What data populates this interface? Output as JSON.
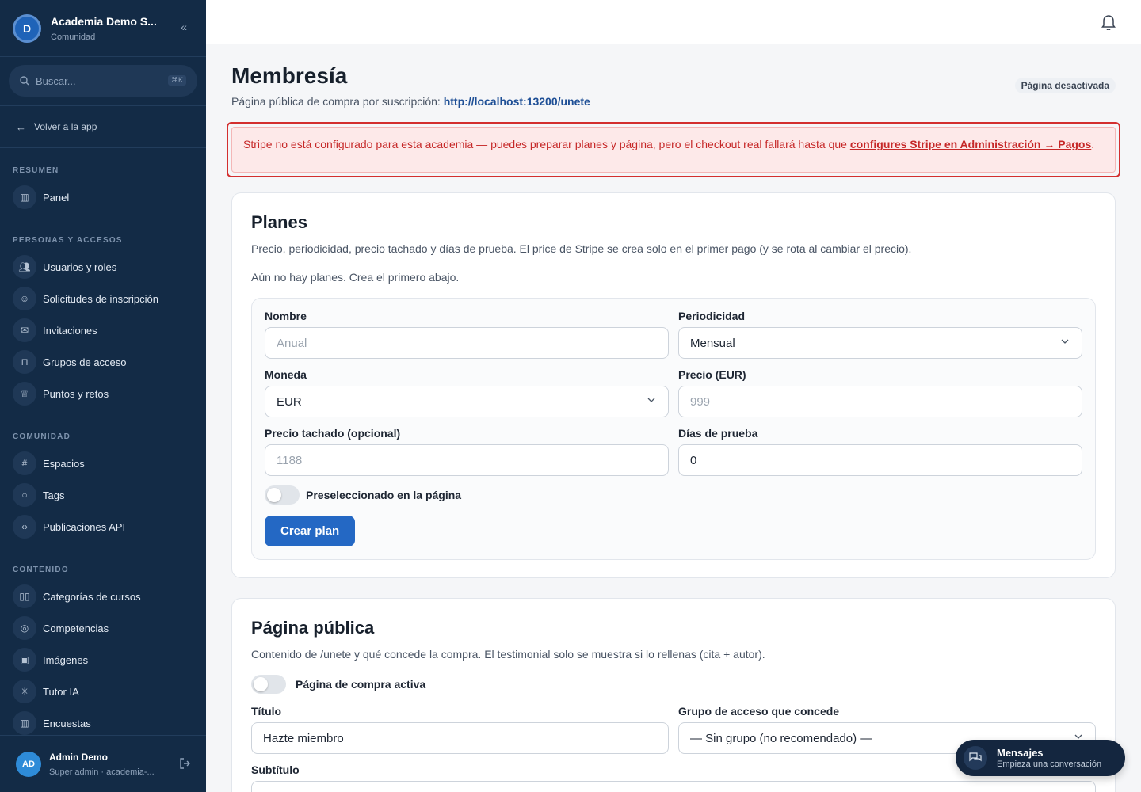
{
  "brand": {
    "name": "Academia Demo S...",
    "subtitle": "Comunidad",
    "logo_text": "D"
  },
  "search": {
    "placeholder": "Buscar...",
    "shortcut": "⌘K"
  },
  "back": {
    "label": "Volver a la app"
  },
  "sections": [
    {
      "title": "RESUMEN",
      "items": [
        {
          "label": "Panel",
          "icon": "chart-icon"
        }
      ]
    },
    {
      "title": "PERSONAS Y ACCESOS",
      "items": [
        {
          "label": "Usuarios y roles",
          "icon": "users-icon"
        },
        {
          "label": "Solicitudes de inscripción",
          "icon": "user-icon"
        },
        {
          "label": "Invitaciones",
          "icon": "mail-icon"
        },
        {
          "label": "Grupos de acceso",
          "icon": "lock-icon"
        },
        {
          "label": "Puntos y retos",
          "icon": "trophy-icon"
        }
      ]
    },
    {
      "title": "COMUNIDAD",
      "items": [
        {
          "label": "Espacios",
          "icon": "hash-icon"
        },
        {
          "label": "Tags",
          "icon": "message-icon"
        },
        {
          "label": "Publicaciones API",
          "icon": "code-icon"
        }
      ]
    },
    {
      "title": "CONTENIDO",
      "items": [
        {
          "label": "Categorías de cursos",
          "icon": "book-icon"
        },
        {
          "label": "Competencias",
          "icon": "award-icon"
        },
        {
          "label": "Imágenes",
          "icon": "image-icon"
        },
        {
          "label": "Tutor IA",
          "icon": "sparkle-icon"
        },
        {
          "label": "Encuestas",
          "icon": "chart-icon"
        }
      ]
    }
  ],
  "user": {
    "initials": "AD",
    "name": "Admin Demo",
    "role": "Super admin · academia-..."
  },
  "page": {
    "title": "Membresía",
    "subtitle": "Página pública de compra por suscripción:",
    "url": "http://localhost:13200/unete",
    "status": "Página desactivada"
  },
  "alert": {
    "text": "Stripe no está configurado para esta academia — puedes preparar planes y página, pero el checkout real fallará hasta que ",
    "link": "configures Stripe en Administración → Pagos",
    "end": "."
  },
  "plans": {
    "title": "Planes",
    "description": "Precio, periodicidad, precio tachado y días de prueba. El price de Stripe se crea solo en el primer pago (y se rota al cambiar el precio).",
    "empty": "Aún no hay planes. Crea el primero abajo.",
    "fields": {
      "name": {
        "label": "Nombre",
        "placeholder": "Anual"
      },
      "period": {
        "label": "Periodicidad",
        "value": "Mensual"
      },
      "currency": {
        "label": "Moneda",
        "value": "EUR"
      },
      "price": {
        "label": "Precio (EUR)",
        "placeholder": "999"
      },
      "strike": {
        "label": "Precio tachado (opcional)",
        "placeholder": "1188"
      },
      "trial": {
        "label": "Días de prueba",
        "value": "0"
      }
    },
    "toggle_label": "Preseleccionado en la página",
    "button": "Crear plan"
  },
  "public_page": {
    "title": "Página pública",
    "description": "Contenido de /unete y qué concede la compra. El testimonial solo se muestra si lo rellenas (cita + autor).",
    "toggle_label": "Página de compra activa",
    "title_field": {
      "label": "Título",
      "value": "Hazte miembro"
    },
    "group_field": {
      "label": "Grupo de acceso que concede",
      "value": "— Sin grupo (no recomendado) —"
    },
    "subtitle_field": {
      "label": "Subtítulo"
    }
  },
  "chat": {
    "title": "Mensajes",
    "subtitle": "Empieza una conversación"
  }
}
